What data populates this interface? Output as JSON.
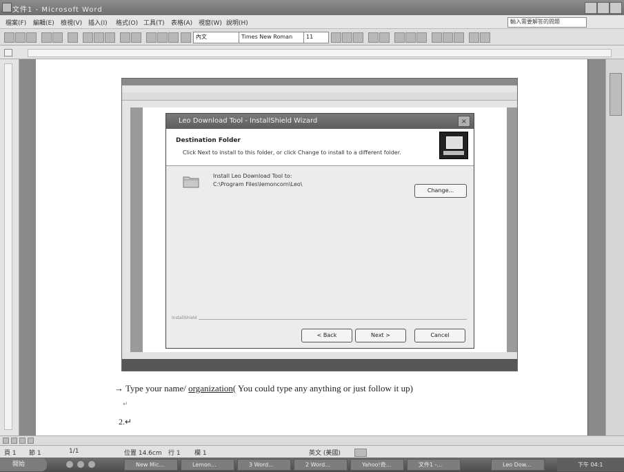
{
  "window": {
    "title": "文件1 - Microsoft Word"
  },
  "menubar": {
    "items": [
      "檔案(F)",
      "編輯(E)",
      "檢視(V)",
      "插入(I)",
      "格式(O)",
      "工具(T)",
      "表格(A)",
      "視窗(W)",
      "說明(H)"
    ],
    "help_placeholder": "輸入需要解答的問題"
  },
  "toolbar": {
    "style": "內文",
    "font": "Times New Roman",
    "size": "11"
  },
  "dialog": {
    "title": "Leo Download Tool - InstallShield Wizard",
    "header_title": "Destination Folder",
    "header_subtitle": "Click Next to install to this folder, or click Change to install to a different folder.",
    "install_label": "Install Leo Download Tool to:",
    "install_path": "C:\\Program Files\\lemoncorn\\Leo\\",
    "brand": "InstallShield",
    "change_label": "Change...",
    "back_label": "< Back",
    "next_label": "Next >",
    "cancel_label": "Cancel",
    "close_label": "×"
  },
  "document": {
    "line1_pre": "→ Type your name/ ",
    "line1_underlined": "organization",
    "line1_post": "( You could type any anything or just follow it up)",
    "para_mark": "↵",
    "line2": "2.↵"
  },
  "statusbar": {
    "page": "頁 1",
    "section": "節 1",
    "pages": "1/1",
    "position": "位置 14.6cm",
    "line": "行 1",
    "column": "欄 1",
    "language": "英文 (美國)"
  },
  "taskbar": {
    "start_label": "開始",
    "tasks": [
      "New Mic...",
      "Lemon...",
      "3 Word...",
      "2 Word...",
      "Yahoo!奇...",
      "文件1 -...",
      "Leo Dow..."
    ],
    "clock": "下午 04:1"
  },
  "colors": {
    "dialog_bg": "#ececec",
    "page_bg": "#ffffff",
    "workspace": "#8a8a8a"
  }
}
